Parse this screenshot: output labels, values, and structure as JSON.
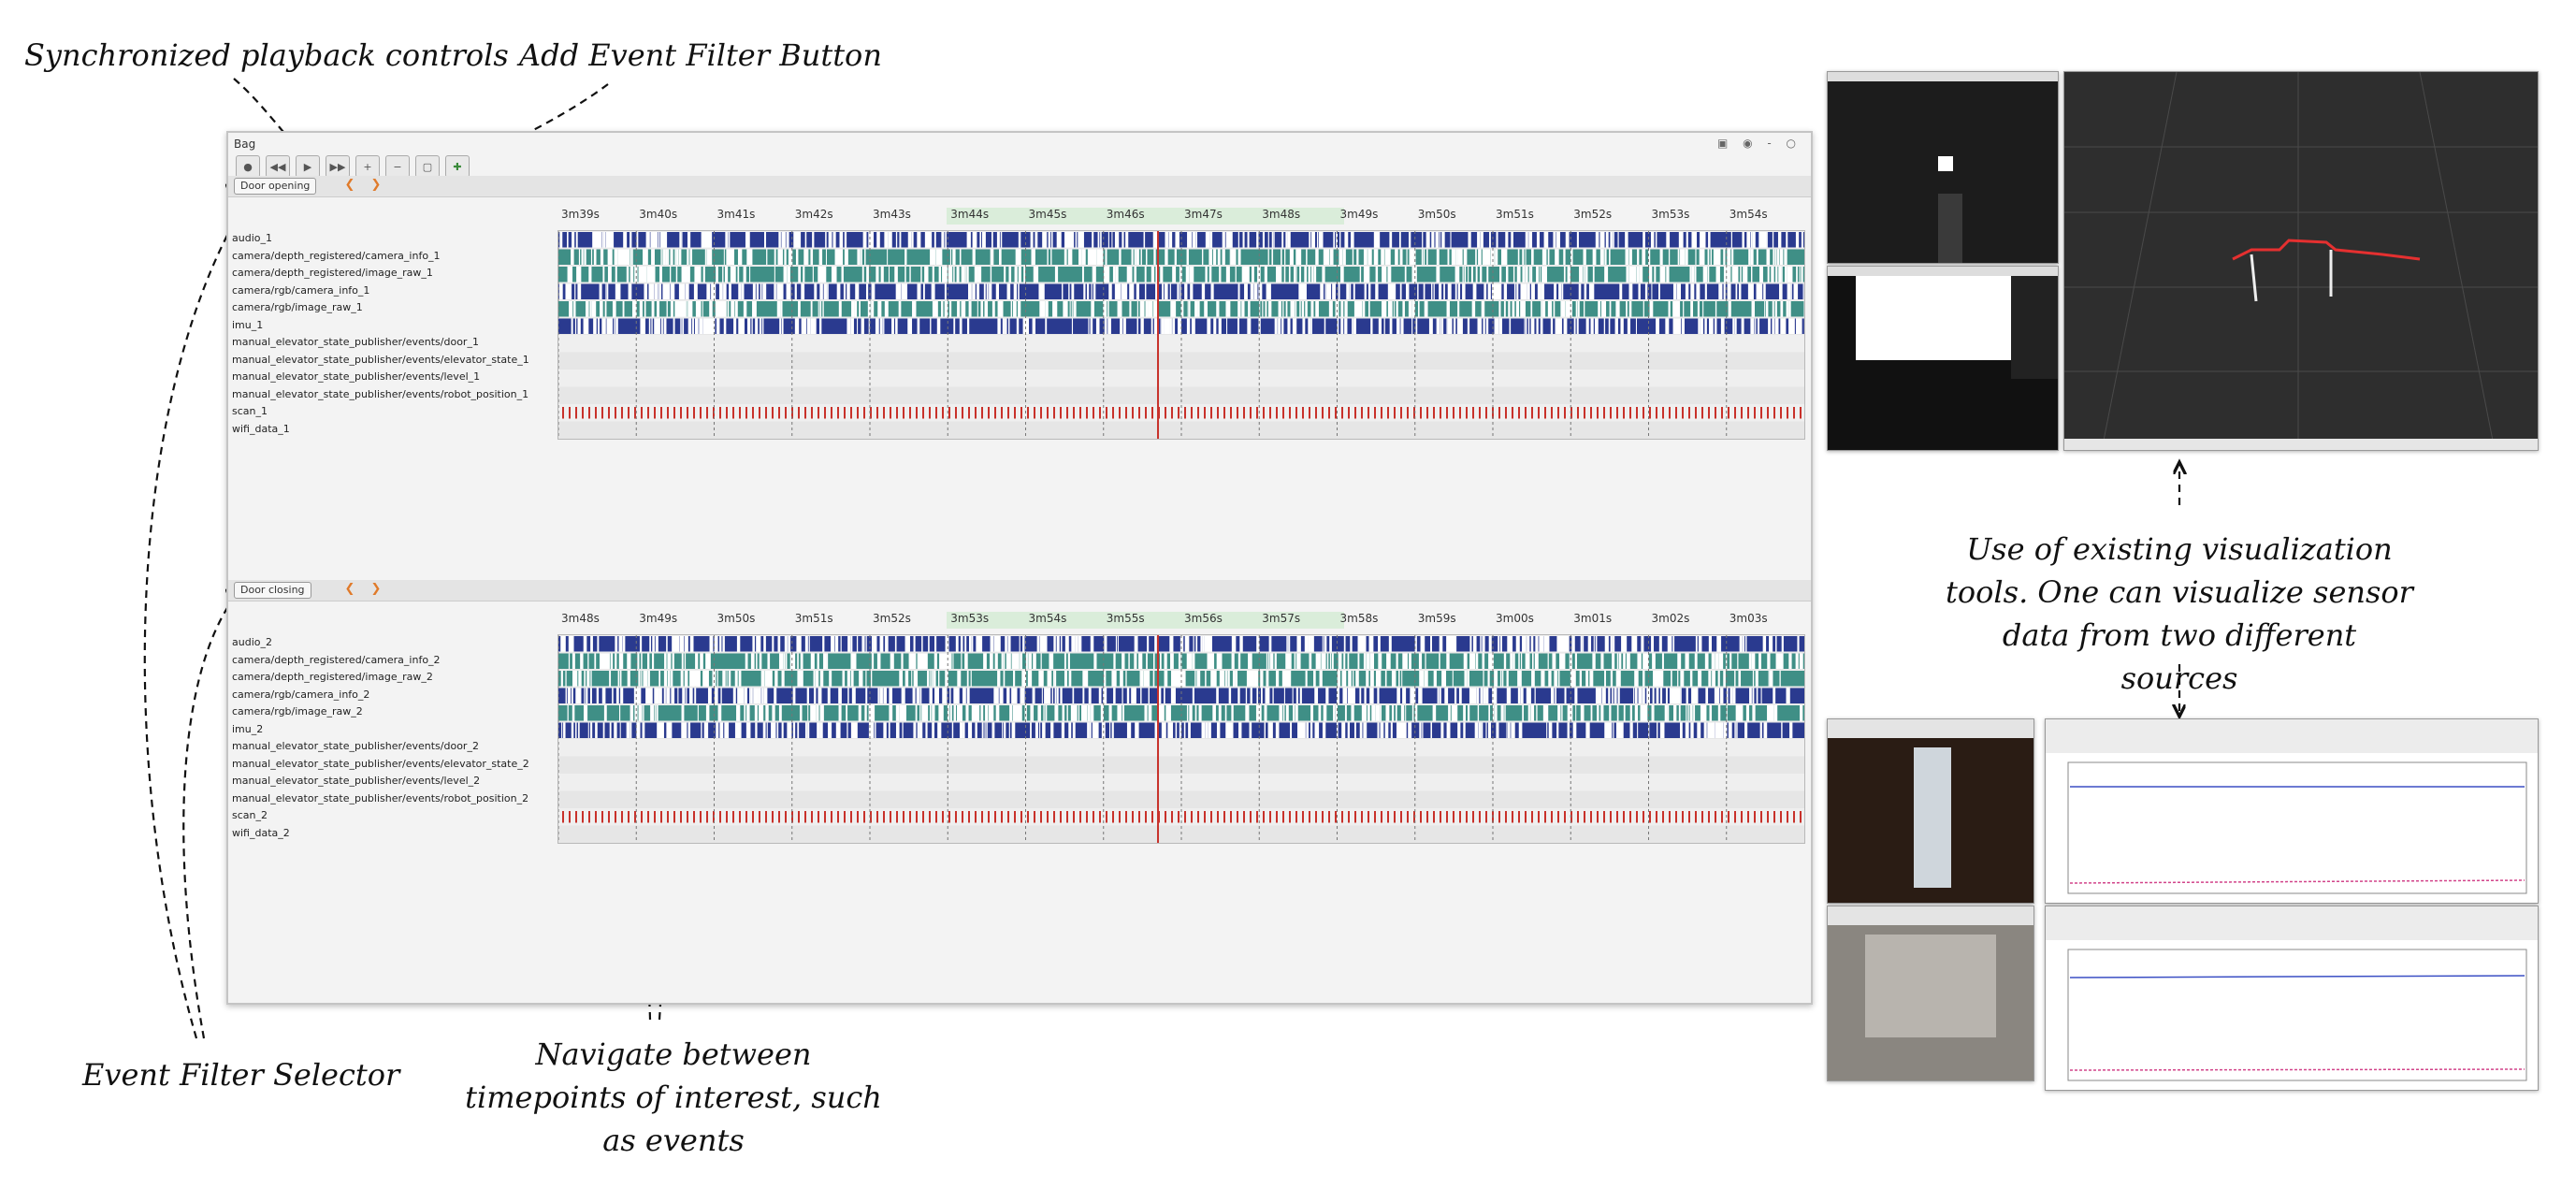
{
  "annotations": {
    "playback": "Synchronized playback controls",
    "add_filter": "Add Event Filter Button",
    "filter_selector": "Event Filter Selector",
    "navigate": "Navigate between timepoints of interest, such as events",
    "viz_tools": "Use of existing visualization tools. One can visualize sensor data from two different sources"
  },
  "window": {
    "title": "Bag"
  },
  "panels": [
    {
      "filter": "Door opening",
      "ticks": [
        "3m39s",
        "3m40s",
        "3m41s",
        "3m42s",
        "3m43s",
        "3m44s",
        "3m45s",
        "3m46s",
        "3m47s",
        "3m48s",
        "3m49s",
        "3m50s",
        "3m51s",
        "3m52s",
        "3m53s",
        "3m54s"
      ],
      "topics": [
        "audio_1",
        "camera/depth_registered/camera_info_1",
        "camera/depth_registered/image_raw_1",
        "camera/rgb/camera_info_1",
        "camera/rgb/image_raw_1",
        "imu_1",
        "manual_elevator_state_publisher/events/door_1",
        "manual_elevator_state_publisher/events/elevator_state_1",
        "manual_elevator_state_publisher/events/level_1",
        "manual_elevator_state_publisher/events/robot_position_1",
        "scan_1",
        "wifi_data_1"
      ]
    },
    {
      "filter": "Door closing",
      "ticks": [
        "3m48s",
        "3m49s",
        "3m50s",
        "3m51s",
        "3m52s",
        "3m53s",
        "3m54s",
        "3m55s",
        "3m56s",
        "3m57s",
        "3m58s",
        "3m59s",
        "3m00s",
        "3m01s",
        "3m02s",
        "3m03s"
      ],
      "topics": [
        "audio_2",
        "camera/depth_registered/camera_info_2",
        "camera/depth_registered/image_raw_2",
        "camera/rgb/camera_info_2",
        "camera/rgb/image_raw_2",
        "imu_2",
        "manual_elevator_state_publisher/events/door_2",
        "manual_elevator_state_publisher/events/elevator_state_2",
        "manual_elevator_state_publisher/events/level_2",
        "manual_elevator_state_publisher/events/robot_position_2",
        "scan_2",
        "wifi_data_2"
      ]
    }
  ],
  "colors": {
    "dense_blue": "#2a3a8f",
    "teal": "#3f8f86",
    "red": "#c8312a",
    "highlight": "#cfe9cf"
  }
}
